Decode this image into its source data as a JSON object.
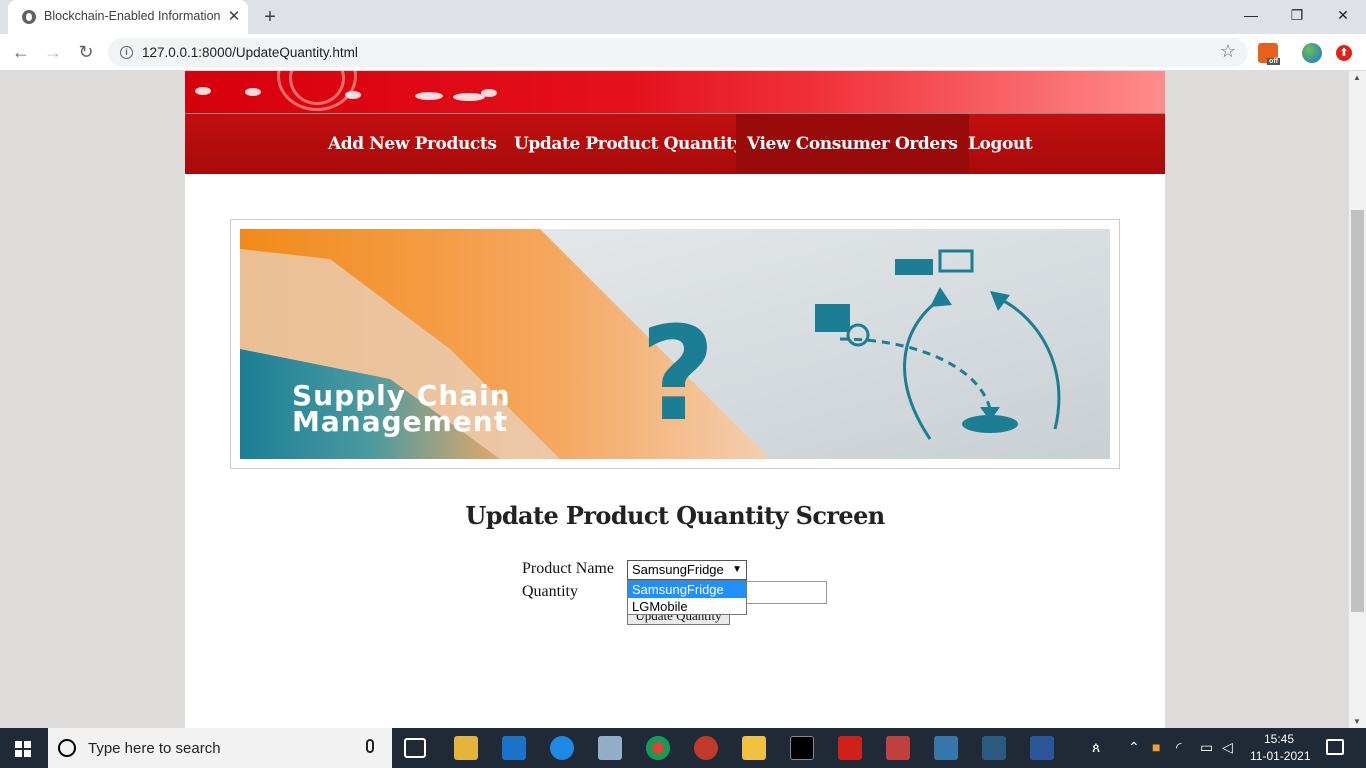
{
  "browser": {
    "tab_title": "Blockchain-Enabled Information",
    "tab_close": "✕",
    "new_tab": "+",
    "url": "127.0.0.1:8000/UpdateQuantity.html",
    "window_controls": {
      "minimize": "—",
      "maximize": "❐",
      "close": "✕"
    },
    "nav": {
      "back": "←",
      "forward": "→",
      "reload": "↻"
    },
    "extension_badge": "off"
  },
  "site": {
    "nav_items": [
      "Add New Products",
      "Update Product Quantity",
      "View Consumer Orders",
      "Logout"
    ],
    "banner_text_line1": "Supply Chain",
    "banner_text_line2": "Management",
    "banner_symbol": "?"
  },
  "form": {
    "title": "Update Product Quantity Screen",
    "product_label": "Product Name",
    "quantity_label": "Quantity",
    "selected_product": "SamsungFridge",
    "product_options": [
      "SamsungFridge",
      "LGMobile"
    ],
    "quantity_value": "",
    "submit_label": "Update Quantity"
  },
  "taskbar": {
    "search_placeholder": "Type here to search",
    "time": "15:45",
    "date": "11-01-2021"
  },
  "colors": {
    "nav_bg": "#b50d0d",
    "nav_active": "#990a0a",
    "option_highlight": "#1e90ff",
    "banner_teal": "#1b7e94",
    "banner_orange": "#f28a1a"
  }
}
